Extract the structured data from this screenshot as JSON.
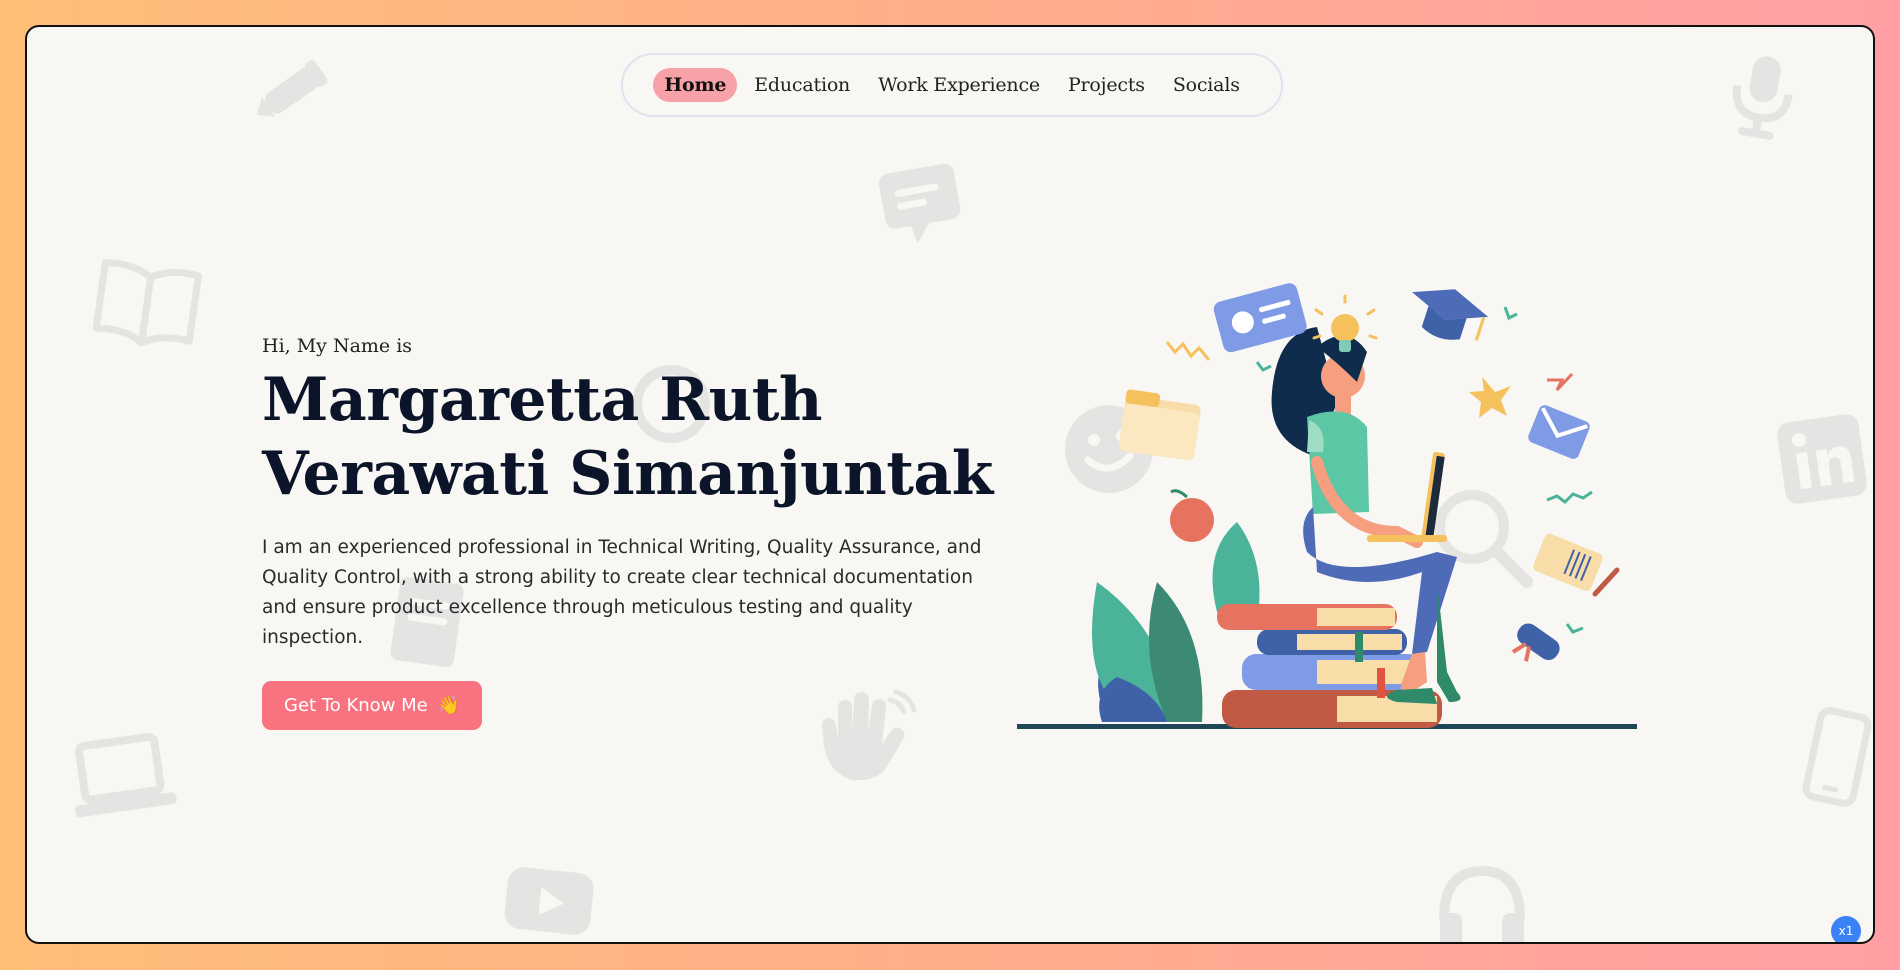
{
  "nav": {
    "items": [
      {
        "label": "Home",
        "active": true
      },
      {
        "label": "Education",
        "active": false
      },
      {
        "label": "Work Experience",
        "active": false
      },
      {
        "label": "Projects",
        "active": false
      },
      {
        "label": "Socials",
        "active": false
      }
    ]
  },
  "hero": {
    "greeting": "Hi, My Name is",
    "name_line1": "Margaretta Ruth",
    "name_line2": "Verawati Simanjuntak",
    "description": "I am an experienced professional in Technical Writing, Quality Assurance, and Quality Control, with a strong ability to create clear technical documentation and ensure product excellence through meticulous testing and quality inspection.",
    "cta_label": "Get To Know Me",
    "cta_emoji": "👋"
  },
  "badge": {
    "label": "x1"
  },
  "colors": {
    "accent": "#f9727f",
    "nav_active": "#f9a1a8",
    "heading": "#0c1429",
    "page_bg": "#f8f7f4"
  },
  "background_icons": [
    "pen-icon",
    "message-icon",
    "microphone-icon",
    "book-icon",
    "smiley-icon",
    "search-icon",
    "linkedin-icon",
    "document-icon",
    "wave-hand-icon",
    "laptop-icon",
    "phone-icon",
    "youtube-icon",
    "headphones-icon"
  ]
}
